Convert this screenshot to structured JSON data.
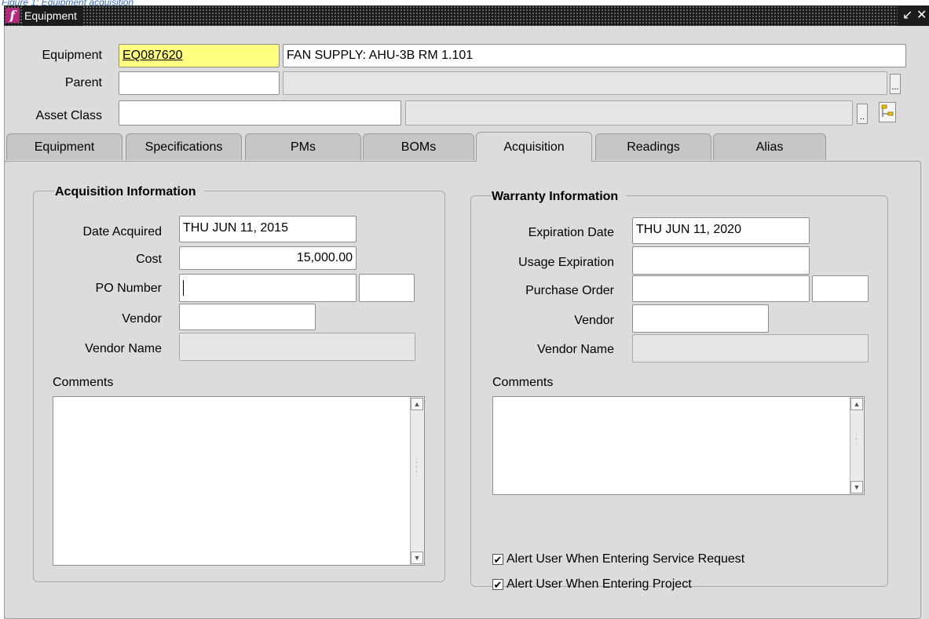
{
  "caption": "Figure 1: Equipment acquisition",
  "window": {
    "title": "Equipment"
  },
  "header": {
    "equipment_label": "Equipment",
    "equipment_id": "EQ087620",
    "equipment_desc": "FAN SUPPLY: AHU-3B RM 1.101",
    "parent_label": "Parent",
    "parent_value": "",
    "parent_desc": "",
    "asset_class_label": "Asset Class",
    "asset_class_value": "",
    "asset_class_desc": ""
  },
  "tabs": [
    {
      "label": "Equipment"
    },
    {
      "label": "Specifications"
    },
    {
      "label": "PMs"
    },
    {
      "label": "BOMs"
    },
    {
      "label": "Acquisition",
      "active": true
    },
    {
      "label": "Readings"
    },
    {
      "label": "Alias"
    }
  ],
  "acquisition": {
    "title": "Acquisition Information",
    "date_acquired_label": "Date Acquired",
    "date_acquired": "THU JUN 11, 2015",
    "cost_label": "Cost",
    "cost": "15,000.00",
    "po_number_label": "PO Number",
    "po_number": "",
    "po_line": "",
    "vendor_label": "Vendor",
    "vendor": "",
    "vendor_name_label": "Vendor Name",
    "vendor_name": "",
    "comments_label": "Comments",
    "comments": ""
  },
  "warranty": {
    "title": "Warranty Information",
    "expiration_date_label": "Expiration Date",
    "expiration_date": "THU JUN 11, 2020",
    "usage_expiration_label": "Usage Expiration",
    "usage_expiration": "",
    "purchase_order_label": "Purchase Order",
    "purchase_order": "",
    "purchase_order_line": "",
    "vendor_label": "Vendor",
    "vendor": "",
    "vendor_name_label": "Vendor Name",
    "vendor_name": "",
    "comments_label": "Comments",
    "comments": "",
    "alert_service_request_label": "Alert User When Entering Service Request",
    "alert_service_request": true,
    "alert_project_label": "Alert User When Entering Project",
    "alert_project": true
  },
  "colors": {
    "required_field": "#ffff80",
    "title_bar": "#1c1c1c",
    "window_bg": "#dcdcdc",
    "logo": "#b2287a"
  }
}
